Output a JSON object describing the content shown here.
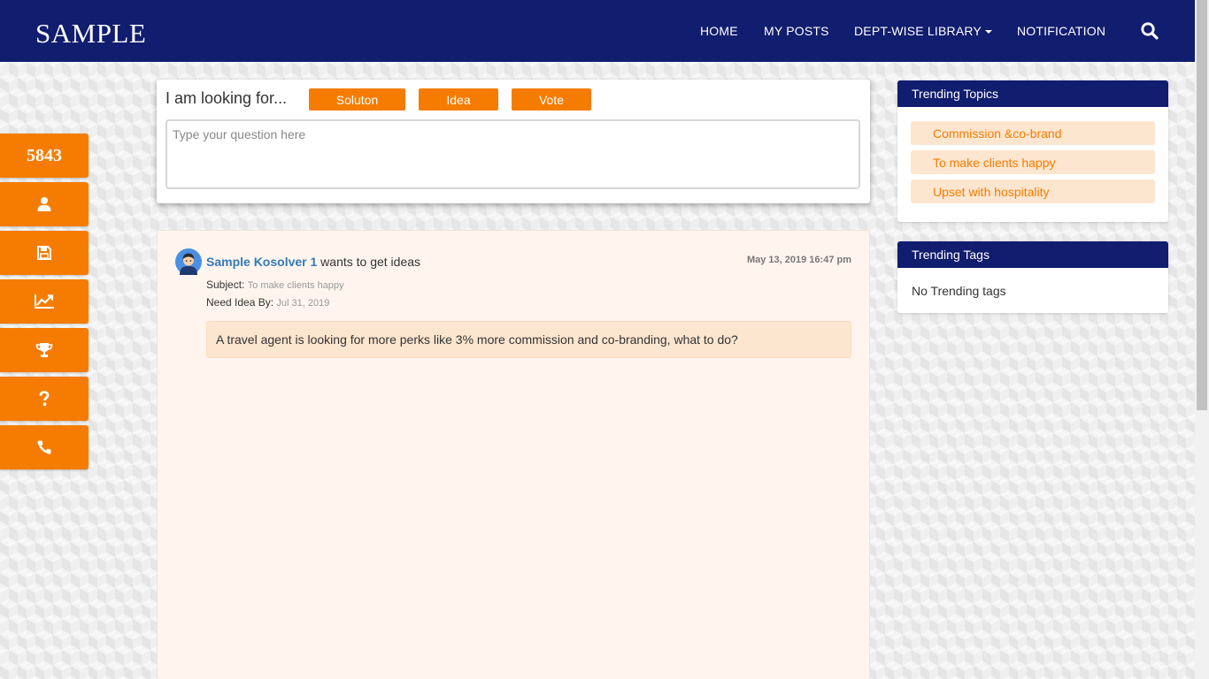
{
  "brand": {
    "name": "SAMPLE"
  },
  "nav": {
    "items": [
      {
        "label": "HOME"
      },
      {
        "label": "MY POSTS"
      },
      {
        "label": "DEPT-WISE LIBRARY"
      },
      {
        "label": "NOTIFICATION"
      }
    ],
    "search_icon": "search-icon"
  },
  "rail": {
    "count": "5843",
    "buttons": [
      {
        "icon": "user-icon"
      },
      {
        "icon": "save-icon"
      },
      {
        "icon": "trending-chart-icon"
      },
      {
        "icon": "trophy-icon"
      },
      {
        "icon": "question-icon"
      },
      {
        "icon": "phone-icon"
      }
    ]
  },
  "ask": {
    "title": "I am looking for...",
    "options": [
      {
        "label": "Soluton"
      },
      {
        "label": "Idea"
      },
      {
        "label": "Vote"
      }
    ],
    "placeholder": "Type your question here"
  },
  "post": {
    "author": "Sample Kosolver 1",
    "action": " wants to get ideas",
    "date": "May 13, 2019 16:47 pm",
    "subject_label": "Subject:",
    "subject_value": "To make clients happy",
    "need_by_label": "Need Idea By:",
    "need_by_value": "Jul 31, 2019",
    "body": "A travel agent is looking for more perks like 3% more commission and co-branding, what to do?"
  },
  "trending_topics": {
    "title": "Trending Topics",
    "items": [
      {
        "label": "Commission &co-brand"
      },
      {
        "label": "To make clients happy"
      },
      {
        "label": "Upset with hospitality"
      }
    ]
  },
  "trending_tags": {
    "title": "Trending Tags",
    "empty_text": "No Trending tags"
  },
  "colors": {
    "navy": "#111d6e",
    "orange": "#f57c00",
    "link_blue": "#337ab7",
    "pill_bg": "#fde6cf"
  }
}
